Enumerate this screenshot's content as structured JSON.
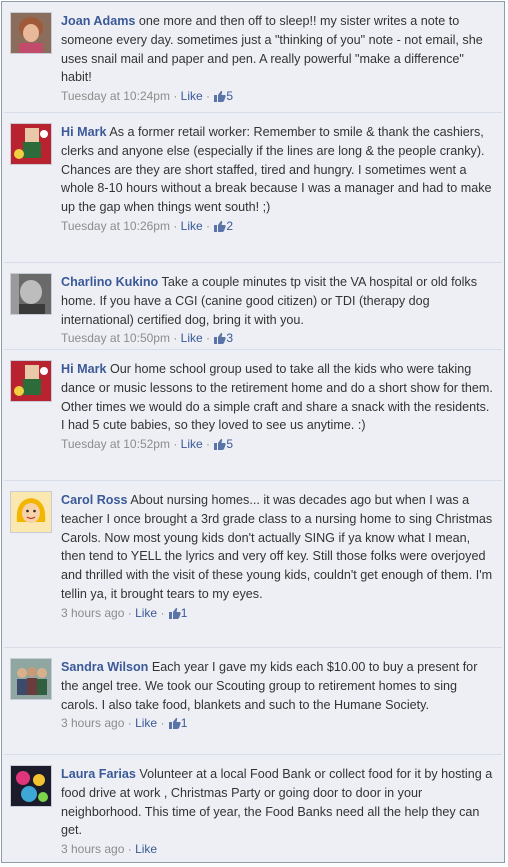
{
  "comments": [
    {
      "author": "Joan Adams",
      "text": "one more and then off to sleep!! my sister writes a note to someone every day. sometimes just a \"thinking of you\" note - not email, she uses snail mail and paper and pen. A really powerful \"make a difference\" habit!",
      "time": "Tuesday at 10:24pm",
      "like_label": "Like",
      "likes": "5"
    },
    {
      "author": "Hi Mark",
      "text": "As a former retail worker: Remember to smile & thank the cashiers, clerks and anyone else (especially if the lines are long & the people cranky). Chances are they are short staffed, tired and hungry. I sometimes went a whole 8-10 hours without a break because I was a manager and had to make up the gap when things went south! ;)",
      "time": "Tuesday at 10:26pm",
      "like_label": "Like",
      "likes": "2"
    },
    {
      "author": "Charlino Kukino",
      "text": "Take a couple minutes tp visit the VA hospital or old folks home. If you have a CGI (canine good citizen) or TDI (therapy dog international) certified dog, bring it with you.",
      "time": "Tuesday at 10:50pm",
      "like_label": "Like",
      "likes": "3"
    },
    {
      "author": "Hi Mark",
      "text": "Our home school group used to take all the kids who were taking dance or music lessons to the retirement home and do a short show for them. Other times we would do a simple craft and share a snack with the residents. I had 5 cute babies, so they loved to see us anytime. :)",
      "time": "Tuesday at 10:52pm",
      "like_label": "Like",
      "likes": "5"
    },
    {
      "author": "Carol Ross",
      "text": "About nursing homes... it was decades ago but when I was a teacher I once brought a 3rd grade class to a nursing home to sing Christmas Carols. Now most young kids don't actually SING if ya know what I mean, then tend to YELL the lyrics and very off key. Still those folks were overjoyed and thrilled with the visit of these young kids, couldn't get enough of them. I'm tellin ya, it brought tears to my eyes.",
      "time": "3 hours ago",
      "like_label": "Like",
      "likes": "1"
    },
    {
      "author": "Sandra Wilson",
      "text": "Each year I gave my kids each $10.00 to buy a present for the angel tree. We took our Scouting group to retirement homes to sing carols. I also take food, blankets and such to the Humane Society.",
      "time": "3 hours ago",
      "like_label": "Like",
      "likes": "1"
    },
    {
      "author": "Laura Farias",
      "text": "Volunteer at a local Food Bank or collect food for it by hosting a food drive at work , Christmas Party or going door to door in your neighborhood. This time of year, the Food Banks need all the help they can get.",
      "time": "3 hours ago",
      "like_label": "Like",
      "likes": ""
    }
  ],
  "colors": {
    "link": "#3b5998",
    "meta": "#8c8c8c",
    "background": "#edeff4"
  }
}
